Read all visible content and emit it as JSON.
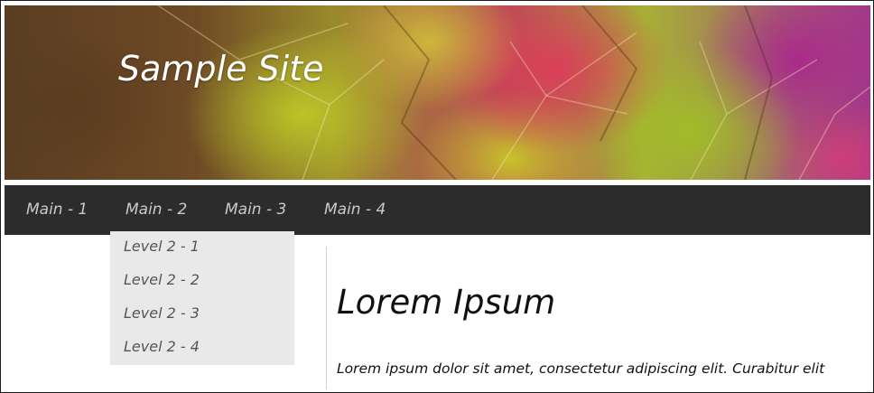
{
  "header": {
    "site_title": "Sample Site"
  },
  "nav": {
    "items": [
      {
        "label": "Main - 1"
      },
      {
        "label": "Main - 2"
      },
      {
        "label": "Main - 3"
      },
      {
        "label": "Main - 4"
      }
    ]
  },
  "dropdown": {
    "items": [
      {
        "label": "Level 2 - 1"
      },
      {
        "label": "Level 2 - 2"
      },
      {
        "label": "Level 2 - 3"
      },
      {
        "label": "Level 2 - 4"
      }
    ]
  },
  "content": {
    "heading": "Lorem Ipsum",
    "paragraph": "Lorem ipsum dolor sit amet, consectetur adipiscing elit. Curabitur elit"
  },
  "colors": {
    "nav_background": "#2c2c2c",
    "nav_text": "#c9c9c9",
    "dropdown_background": "#e9e9e9",
    "title_text": "#ffffff"
  }
}
